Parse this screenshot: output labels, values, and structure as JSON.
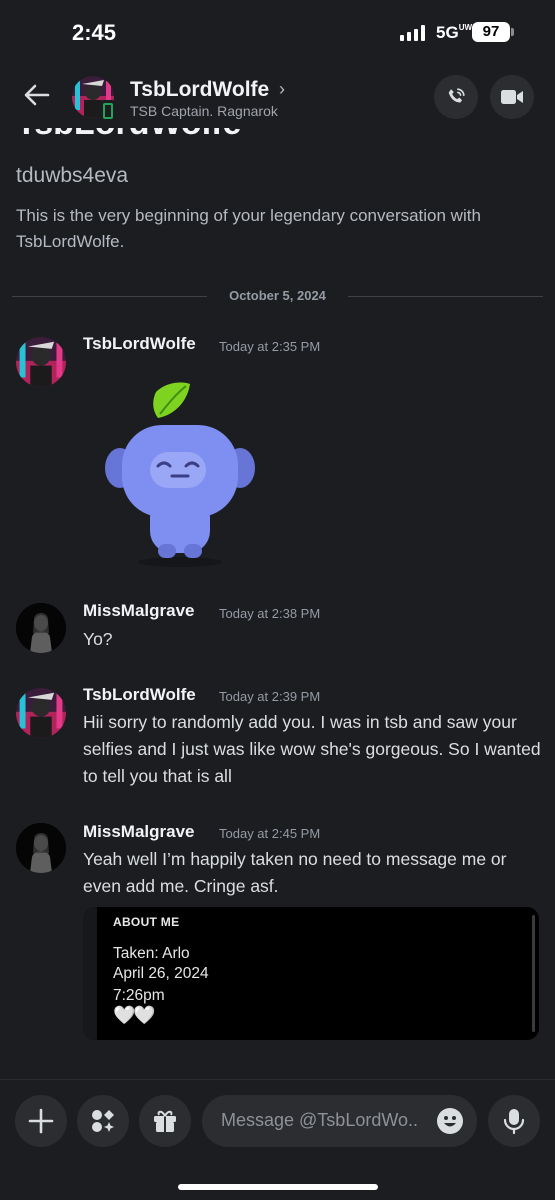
{
  "status_bar": {
    "time": "2:45",
    "network": "5G",
    "network_suffix": "UW",
    "battery": "97"
  },
  "header": {
    "name": "TsbLordWolfe",
    "chevron": "›",
    "subtitle": "TSB Captain. Ragnarok",
    "icons": [
      "back-arrow-icon",
      "phone-icon",
      "video-icon"
    ]
  },
  "intro": {
    "name_cut": "TsbLordWolfe",
    "username": "tduwbs4eva",
    "description": "This is the very beginning of your legendary conversation with TsbLordWolfe."
  },
  "divider": {
    "date": "October 5, 2024"
  },
  "messages": [
    {
      "author": "TsbLordWolfe",
      "timestamp": "Today at 2:35 PM",
      "text": ""
    },
    {
      "author": "MissMalgrave",
      "timestamp": "Today at 2:38 PM",
      "text": "Yo?"
    },
    {
      "author": "TsbLordWolfe",
      "timestamp": "Today at 2:39 PM",
      "text": "Hii sorry to randomly add you. I was in tsb and saw your selfies and I just was like wow she's gorgeous. So I wanted to tell you that is all"
    },
    {
      "author": "MissMalgrave",
      "timestamp": "Today at 2:45 PM",
      "text": "Yeah well I’m happily taken no need to message me or even add me. Cringe asf."
    }
  ],
  "embed": {
    "title": "ABOUT ME",
    "lines": [
      "Taken: Arlo",
      "April 26, 2024",
      "7:26pm"
    ],
    "hearts": "🤍🤍"
  },
  "composer": {
    "placeholder": "Message @TsbLordWo..",
    "icons": [
      "plus-icon",
      "apps-icon",
      "gift-icon",
      "emoji-icon",
      "microphone-icon"
    ]
  },
  "colors": {
    "background": "#1c1d21",
    "button": "#2b2d31",
    "online": "#23a559",
    "wumpus": "#7e8ef1",
    "leaf": "#7ed321"
  }
}
